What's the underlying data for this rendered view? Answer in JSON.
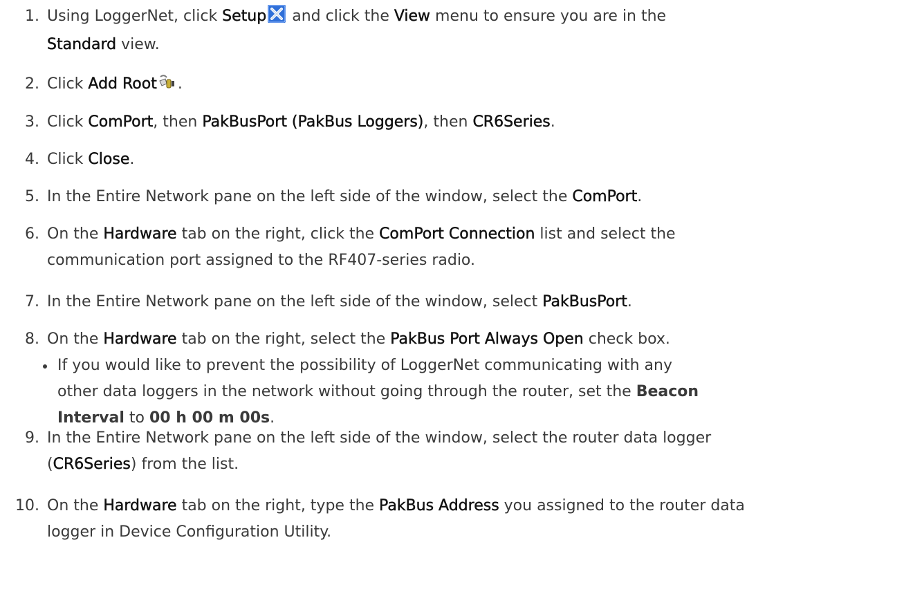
{
  "steps": [
    {
      "num": "1.",
      "parts": [
        {
          "t": "Using LoggerNet, click "
        },
        {
          "t": "Setup",
          "b": true
        },
        {
          "icon": "setup-icon"
        },
        {
          "t": " and click the "
        },
        {
          "t": "View",
          "b": true
        },
        {
          "t": " menu to ensure you are in the "
        },
        {
          "br": true
        },
        {
          "t": "Standard",
          "b": true
        },
        {
          "t": " view."
        }
      ]
    },
    {
      "num": "2.",
      "parts": [
        {
          "t": "Click "
        },
        {
          "t": "Add Root",
          "b": true
        },
        {
          "icon": "add-root-icon"
        },
        {
          "t": "."
        }
      ]
    },
    {
      "num": "3.",
      "parts": [
        {
          "t": "Click "
        },
        {
          "t": "ComPort",
          "b": true
        },
        {
          "t": ", then "
        },
        {
          "t": "PakBusPort (PakBus Loggers)",
          "b": true
        },
        {
          "t": ", then "
        },
        {
          "t": "CR6Series",
          "b": true
        },
        {
          "t": "."
        }
      ]
    },
    {
      "num": "4.",
      "parts": [
        {
          "t": "Click "
        },
        {
          "t": "Close",
          "b": true
        },
        {
          "t": "."
        }
      ]
    },
    {
      "num": "5.",
      "parts": [
        {
          "t": "In the Entire Network pane on the left side of the window, select the "
        },
        {
          "t": "ComPort",
          "b": true
        },
        {
          "t": "."
        }
      ]
    },
    {
      "num": "6.",
      "parts": [
        {
          "t": "On the "
        },
        {
          "t": "Hardware",
          "b": true
        },
        {
          "t": " tab on the right, click the "
        },
        {
          "t": "ComPort Connection",
          "b": true
        },
        {
          "t": " list and select the"
        },
        {
          "br": true
        },
        {
          "t": "communication port assigned to the RF407-series radio."
        }
      ]
    },
    {
      "num": "7.",
      "parts": [
        {
          "t": "In the Entire Network pane on the left side of the window, select "
        },
        {
          "t": "PakBusPort",
          "b": true
        },
        {
          "t": "."
        }
      ]
    },
    {
      "num": "8.",
      "parts": [
        {
          "t": "On the "
        },
        {
          "t": "Hardware",
          "b": true
        },
        {
          "t": " tab on the right, select the "
        },
        {
          "t": "PakBus Port Always Open",
          "b": true
        },
        {
          "t": " check box."
        }
      ],
      "bullet": [
        {
          "t": "If you would like to prevent the possibility of LoggerNet communicating with any"
        },
        {
          "br": true
        },
        {
          "t": "other data loggers in the network without going through the router, set the "
        },
        {
          "t": "Beacon",
          "b": true
        },
        {
          "br": true
        },
        {
          "t": "Interval",
          "b": true
        },
        {
          "t": " to "
        },
        {
          "t": "00 h 00 m 00s",
          "b": true
        },
        {
          "t": "."
        }
      ]
    },
    {
      "num": "9.",
      "parts": [
        {
          "t": "In the Entire Network pane on the left side of the window, select the router data logger"
        },
        {
          "br": true
        },
        {
          "t": "("
        },
        {
          "t": "CR6Series",
          "b": true
        },
        {
          "t": ") from the list."
        }
      ]
    },
    {
      "num": "10.",
      "parts": [
        {
          "t": "On the "
        },
        {
          "t": "Hardware",
          "b": true
        },
        {
          "t": " tab on the right, type the "
        },
        {
          "t": "PakBus Address",
          "b": true
        },
        {
          "t": " you assigned to the router data"
        },
        {
          "br": true
        },
        {
          "t": "logger in Device Configuration Utility."
        }
      ]
    }
  ],
  "colors": {
    "text": "#3a3a3a",
    "bold": "#111111",
    "setup_icon_bg": "#2f6fd8"
  }
}
